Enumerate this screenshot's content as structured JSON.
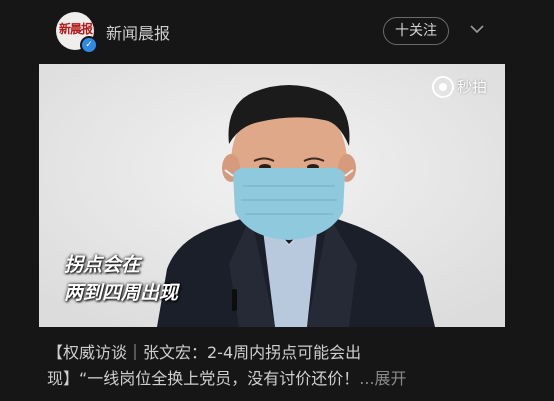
{
  "header": {
    "avatar_logo_text": "新晨报",
    "account_name": "新闻晨报",
    "follow_label": "十关注"
  },
  "video": {
    "caption_line1": "拐点会在",
    "caption_line2": "两到四周出现",
    "watermark_text": "秒拍"
  },
  "post": {
    "line1": "【权威访谈｜张文宏：2-4周内拐点可能会出",
    "line2": "现】“一线岗位全换上党员，没有讨价还价！",
    "more": "...展开"
  },
  "colors": {
    "background": "#161616",
    "verified_badge": "#2f8ae6",
    "mask": "#8ec9de",
    "suit": "#1b1f2a"
  }
}
